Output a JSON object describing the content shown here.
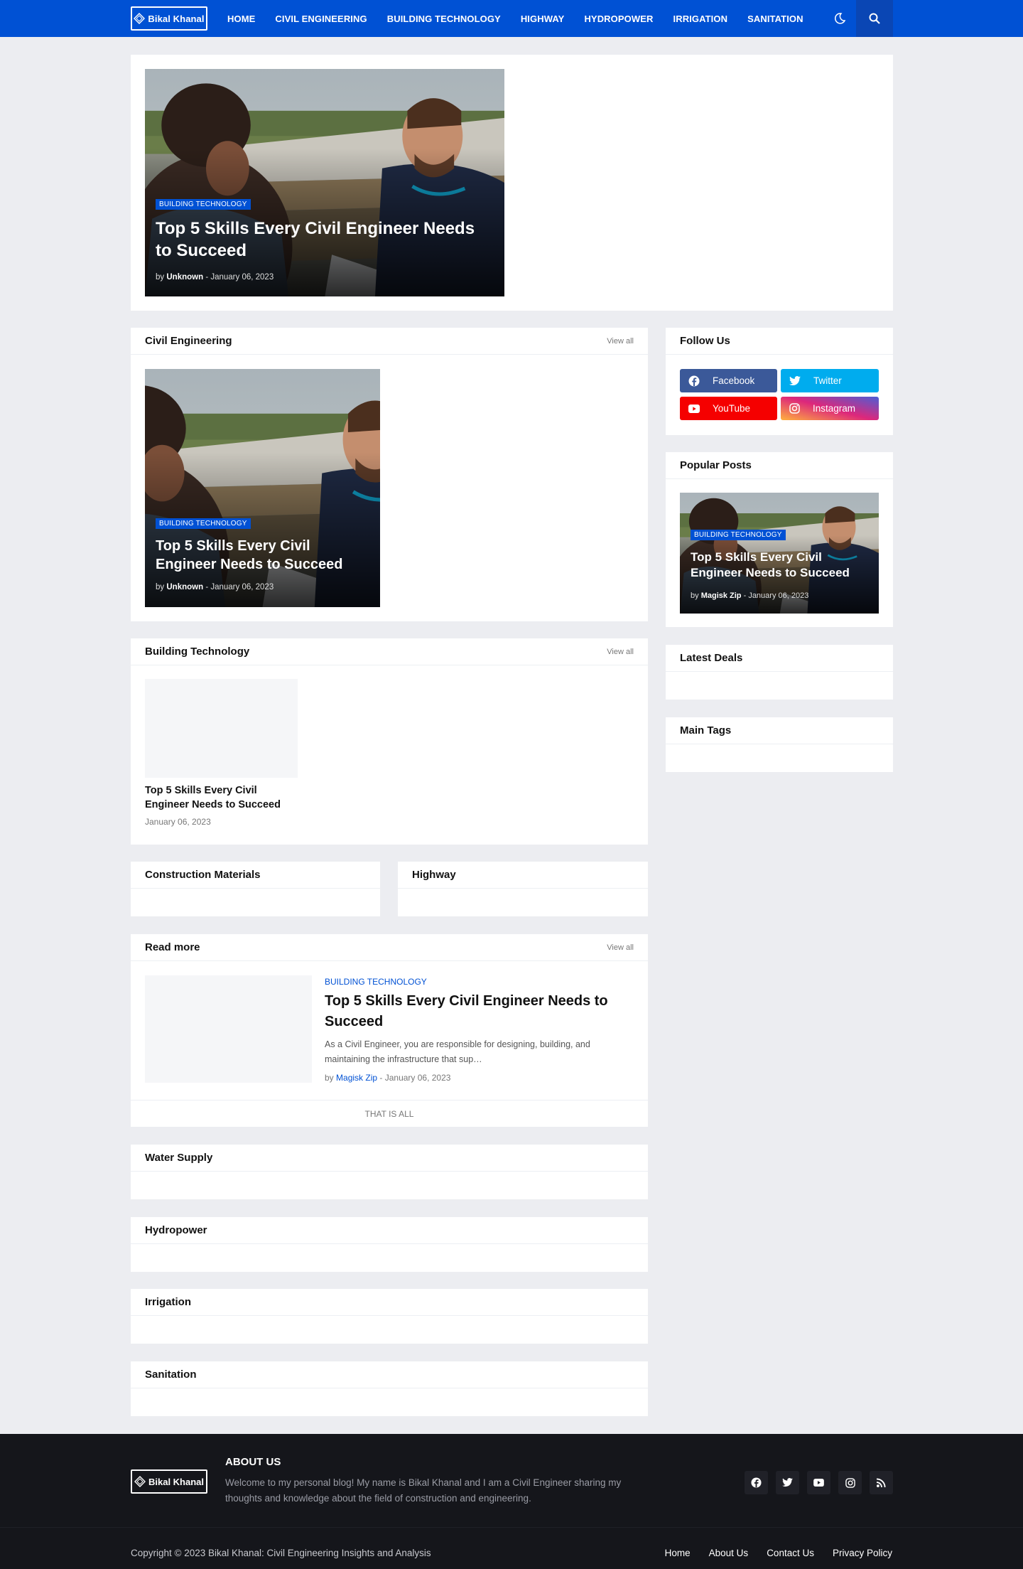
{
  "header": {
    "logo_text": "Bikal Khanal",
    "nav": [
      "HOME",
      "CIVIL ENGINEERING",
      "BUILDING TECHNOLOGY",
      "HIGHWAY",
      "HYDROPOWER",
      "IRRIGATION",
      "SANITATION"
    ],
    "icons": [
      "moon-icon",
      "search-icon"
    ],
    "brand_color": "#0051d4"
  },
  "featured": {
    "tag": "BUILDING TECHNOLOGY",
    "title": "Top 5 Skills Every Civil Engineer Needs to Succeed",
    "by": "by",
    "author": "Unknown",
    "date": "- January 06, 2023"
  },
  "civil": {
    "title": "Civil Engineering",
    "view_all": "View all",
    "post": {
      "tag": "BUILDING TECHNOLOGY",
      "title": "Top 5 Skills Every Civil Engineer Needs to Succeed",
      "by": "by",
      "author": "Unknown",
      "date": "- January 06, 2023"
    }
  },
  "building": {
    "title": "Building Technology",
    "view_all": "View all",
    "post": {
      "title": "Top 5 Skills Every Civil Engineer Needs to Succeed",
      "date": "January 06, 2023"
    }
  },
  "construction": {
    "title": "Construction Materials"
  },
  "highway": {
    "title": "Highway"
  },
  "readmore": {
    "title": "Read more",
    "view_all": "View all",
    "post": {
      "tag": "BUILDING TECHNOLOGY",
      "title": "Top 5 Skills Every Civil Engineer Needs to Succeed",
      "excerpt": "As a Civil Engineer, you are responsible for designing, building, and maintaining the infrastructure that sup…",
      "by": "by",
      "author": "Magisk Zip",
      "date": "- January 06, 2023"
    },
    "end_text": "THAT IS ALL"
  },
  "sections": {
    "water": "Water Supply",
    "hydro": "Hydropower",
    "irrigation": "Irrigation",
    "sanitation": "Sanitation"
  },
  "sidebar": {
    "follow": {
      "title": "Follow Us",
      "facebook": "Facebook",
      "twitter": "Twitter",
      "youtube": "YouTube",
      "instagram": "Instagram"
    },
    "popular": {
      "title": "Popular Posts",
      "post": {
        "tag": "BUILDING TECHNOLOGY",
        "title": "Top 5 Skills Every Civil Engineer Needs to Succeed",
        "by": "by",
        "author": "Magisk Zip",
        "date": "- January 06, 2023"
      }
    },
    "deals": {
      "title": "Latest Deals"
    },
    "tags": {
      "title": "Main Tags"
    }
  },
  "footer": {
    "logo_text": "Bikal Khanal",
    "about_title": "ABOUT US",
    "about_text": "Welcome to my personal blog! My name is Bikal Khanal and I am a Civil Engineer sharing my thoughts and knowledge about the field of construction and engineering.",
    "copyright": "Copyright © 2023 Bikal Khanal: Civil Engineering Insights and Analysis",
    "links": [
      "Home",
      "About Us",
      "Contact Us",
      "Privacy Policy"
    ],
    "social_icons": [
      "facebook-icon",
      "twitter-icon",
      "youtube-icon",
      "instagram-icon",
      "rss-icon"
    ]
  }
}
